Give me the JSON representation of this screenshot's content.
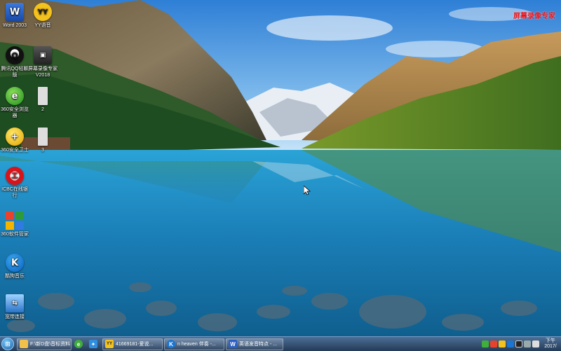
{
  "overlay": {
    "watermark": "屏幕录像专家"
  },
  "desktop_icons": [
    {
      "id": "word",
      "label": "Word 2003",
      "glyph": "W"
    },
    {
      "id": "yy",
      "label": "YY语音",
      "glyph": "YY"
    },
    {
      "id": "qq",
      "label": "腾讯QQ轻聊版",
      "glyph": "Q"
    },
    {
      "id": "recorder",
      "label": "屏幕录像专家V2018",
      "glyph": "▣"
    },
    {
      "id": "browser360",
      "label": "360安全浏览器",
      "glyph": "e"
    },
    {
      "id": "file2",
      "label": "2",
      "glyph": ""
    },
    {
      "id": "guard360",
      "label": "360安全卫士",
      "glyph": "+"
    },
    {
      "id": "file3",
      "label": "3",
      "glyph": ""
    },
    {
      "id": "icbc",
      "label": "ICBC在线银行",
      "glyph": "工"
    },
    {
      "id": "soft360",
      "label": "360软件管家",
      "glyph": ""
    },
    {
      "id": "kugou",
      "label": "酷狗音乐",
      "glyph": "K"
    },
    {
      "id": "broadband",
      "label": "宽带连接",
      "glyph": "⇆"
    }
  ],
  "taskbar": {
    "items": [
      {
        "id": "explorer",
        "label": "F:\\新D盘\\音标资料",
        "glyph": "📁"
      },
      {
        "id": "ie",
        "label": "",
        "glyph": "e"
      },
      {
        "id": "app-blue",
        "label": "",
        "glyph": "✦"
      },
      {
        "id": "yy",
        "label": "41669181-爱说...",
        "glyph": "YY"
      },
      {
        "id": "kugou",
        "label": "n heaven 伴奏 -...",
        "glyph": "K"
      },
      {
        "id": "word",
        "label": "英语发音特点 - ...",
        "glyph": "W"
      }
    ],
    "clock": {
      "period": "下午",
      "date": "2017/"
    }
  },
  "colors": {
    "sky": "#3d8ed9",
    "lake": "#1f86b8",
    "watermark": "#e8141b",
    "taskbar": "#35557c"
  }
}
